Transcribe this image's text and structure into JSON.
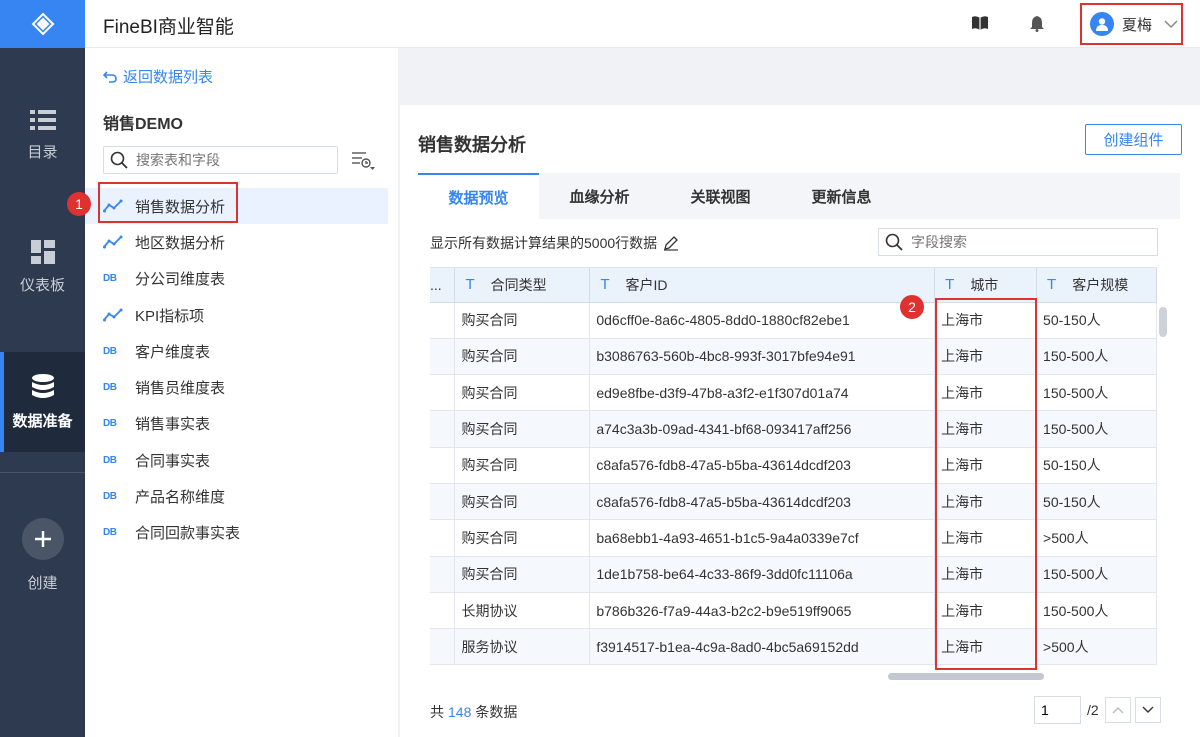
{
  "app": {
    "title": "FineBI商业智能"
  },
  "user": {
    "name": "夏梅"
  },
  "nav": {
    "items": [
      {
        "label": "目录",
        "icon": "list-icon"
      },
      {
        "label": "仪表板",
        "icon": "dashboard-icon"
      },
      {
        "label": "数据准备",
        "icon": "database-icon",
        "active": true
      },
      {
        "label": "创建",
        "icon": "plus-icon"
      }
    ]
  },
  "left": {
    "back_label": "返回数据列表",
    "package_title": "销售DEMO",
    "search_placeholder": "搜索表和字段",
    "db_badge": "DB",
    "tables": [
      {
        "label": "销售数据分析",
        "type": "analysis",
        "selected": true
      },
      {
        "label": "地区数据分析",
        "type": "analysis"
      },
      {
        "label": "分公司维度表",
        "type": "db"
      },
      {
        "label": "KPI指标项",
        "type": "analysis"
      },
      {
        "label": "客户维度表",
        "type": "db"
      },
      {
        "label": "销售员维度表",
        "type": "db"
      },
      {
        "label": "销售事实表",
        "type": "db"
      },
      {
        "label": "合同事实表",
        "type": "db"
      },
      {
        "label": "产品名称维度",
        "type": "db"
      },
      {
        "label": "合同回款事实表",
        "type": "db"
      }
    ]
  },
  "annotations": {
    "one": "1",
    "two": "2"
  },
  "main": {
    "title": "销售数据分析",
    "create_button": "创建组件",
    "tabs": [
      "数据预览",
      "血缘分析",
      "关联视图",
      "更新信息"
    ],
    "info": "显示所有数据计算结果的5000行数据",
    "field_search_placeholder": "字段搜索",
    "type_glyph": "T",
    "columns": [
      "...",
      "合同类型",
      "客户ID",
      "城市",
      "客户规模"
    ],
    "rows": [
      [
        "",
        "购买合同",
        "0d6cff0e-8a6c-4805-8dd0-1880cf82ebe1",
        "上海市",
        "50-150人"
      ],
      [
        "",
        "购买合同",
        "b3086763-560b-4bc8-993f-3017bfe94e91",
        "上海市",
        "150-500人"
      ],
      [
        "",
        "购买合同",
        "ed9e8fbe-d3f9-47b8-a3f2-e1f307d01a74",
        "上海市",
        "150-500人"
      ],
      [
        "",
        "购买合同",
        "a74c3a3b-09ad-4341-bf68-093417aff256",
        "上海市",
        "150-500人"
      ],
      [
        "",
        "购买合同",
        "c8afa576-fdb8-47a5-b5ba-43614dcdf203",
        "上海市",
        "50-150人"
      ],
      [
        "",
        "购买合同",
        "c8afa576-fdb8-47a5-b5ba-43614dcdf203",
        "上海市",
        "50-150人"
      ],
      [
        "",
        "购买合同",
        "ba68ebb1-4a93-4651-b1c5-9a4a0339e7cf",
        "上海市",
        ">500人"
      ],
      [
        "",
        "购买合同",
        "1de1b758-be64-4c33-86f9-3dd0fc11106a",
        "上海市",
        "150-500人"
      ],
      [
        "",
        "长期协议",
        "b786b326-f7a9-44a3-b2c2-b9e519ff9065",
        "上海市",
        "150-500人"
      ],
      [
        "",
        "服务协议",
        "f3914517-b1ea-4c9a-8ad0-4bc5a69152dd",
        "上海市",
        ">500人"
      ]
    ],
    "footer": {
      "prefix": "共",
      "count": "148",
      "suffix": "条数据",
      "page": "1",
      "total_pages": "/2"
    }
  },
  "colors": {
    "accent": "#3685f2",
    "nav_bg": "#2e3a4f",
    "highlight": "#e03131"
  }
}
